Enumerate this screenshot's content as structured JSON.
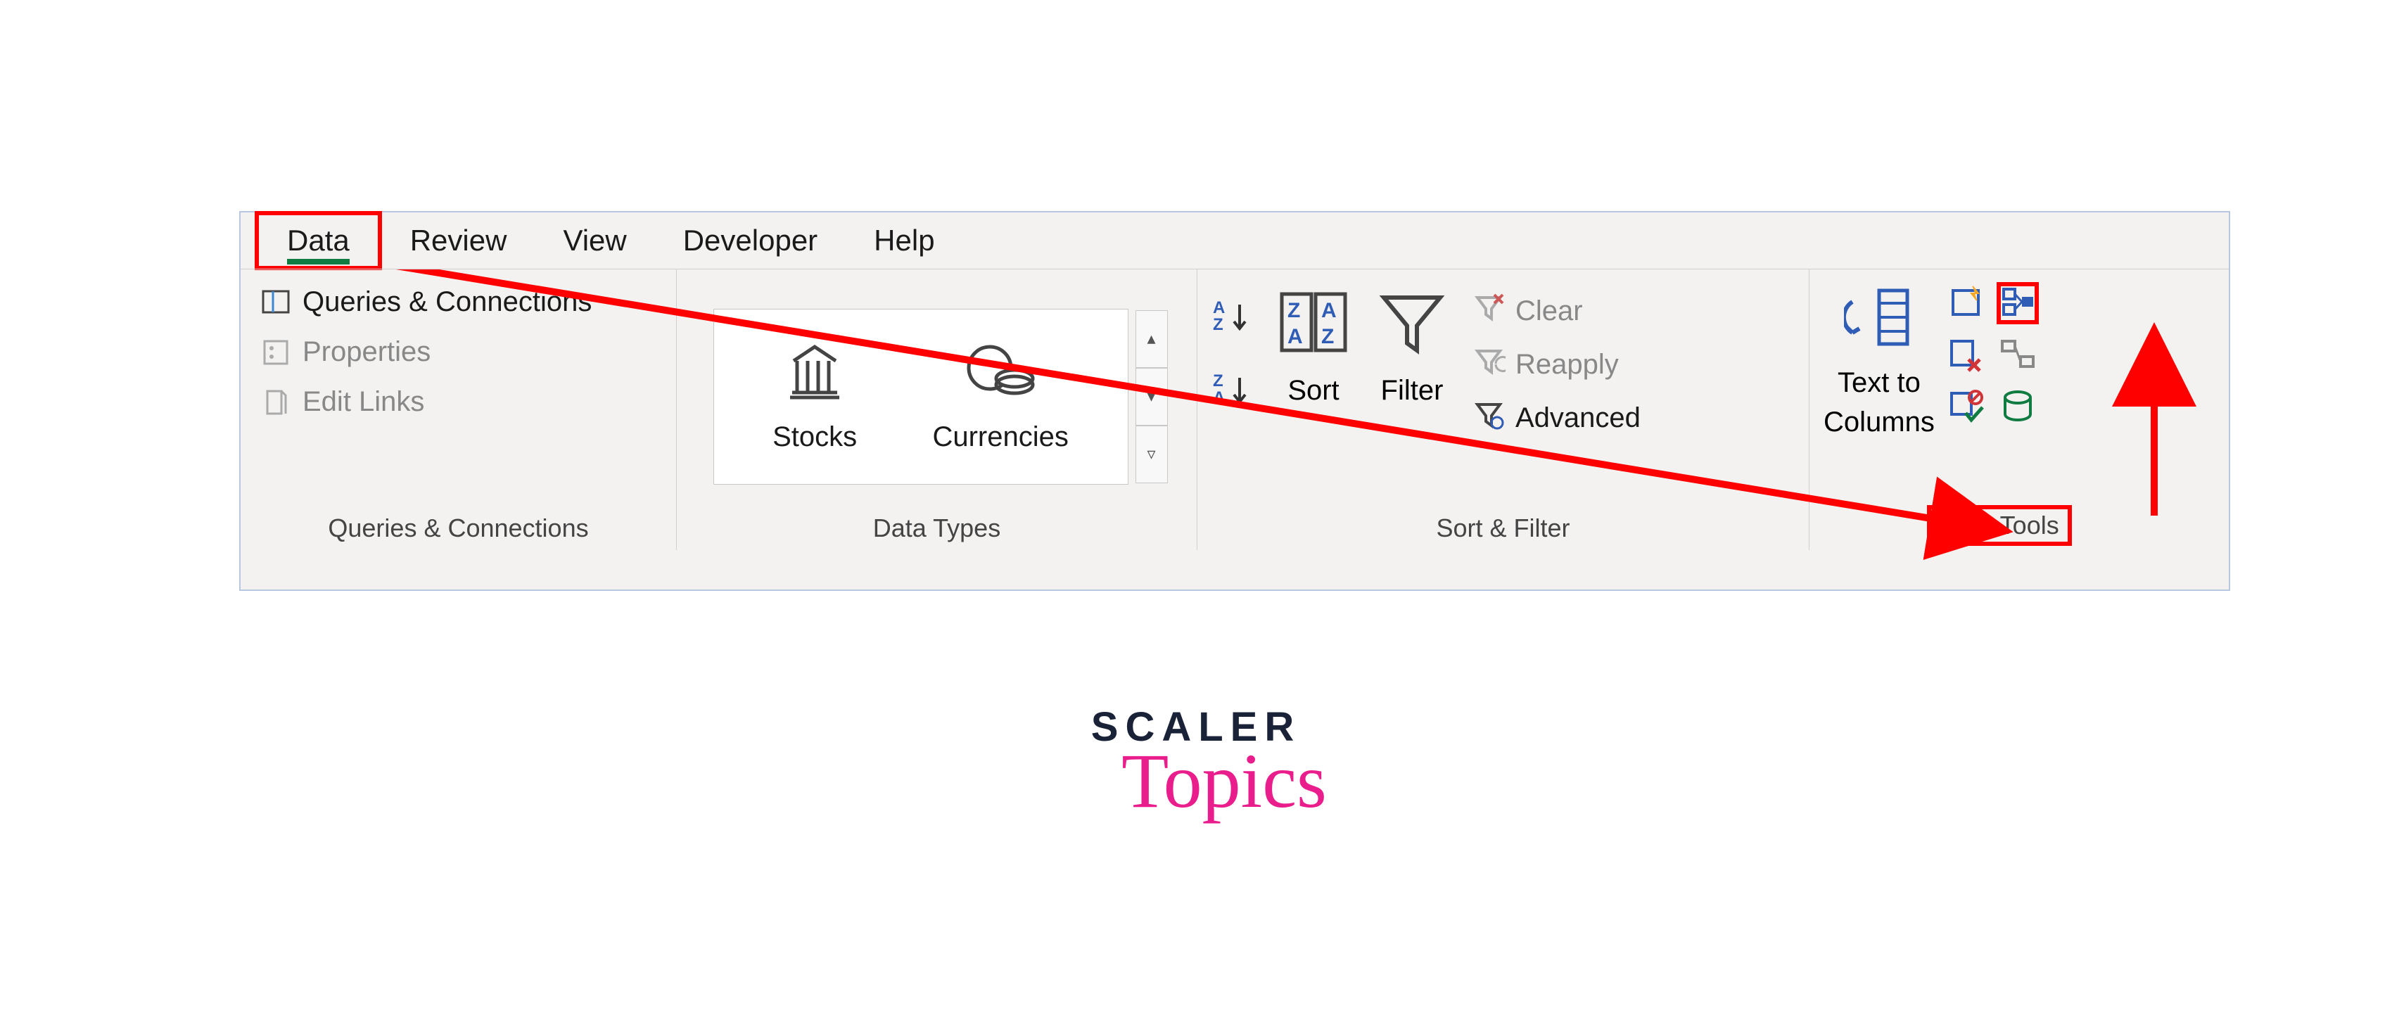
{
  "tabs": {
    "data": "Data",
    "review": "Review",
    "view": "View",
    "developer": "Developer",
    "help": "Help"
  },
  "queries_connections": {
    "btn_queries": "Queries & Connections",
    "btn_properties": "Properties",
    "btn_edit_links": "Edit Links",
    "group_label": "Queries & Connections"
  },
  "data_types": {
    "stocks": "Stocks",
    "currencies": "Currencies",
    "group_label": "Data Types"
  },
  "sort_filter": {
    "sort": "Sort",
    "filter": "Filter",
    "clear": "Clear",
    "reapply": "Reapply",
    "advanced": "Advanced",
    "group_label": "Sort & Filter"
  },
  "data_tools": {
    "text_to_columns_line1": "Text to",
    "text_to_columns_line2": "Columns",
    "group_label": "Data Tools"
  },
  "watermark": {
    "line1": "SCALER",
    "line2": "Topics"
  },
  "annotation": {
    "highlight_color": "#ff0000"
  }
}
